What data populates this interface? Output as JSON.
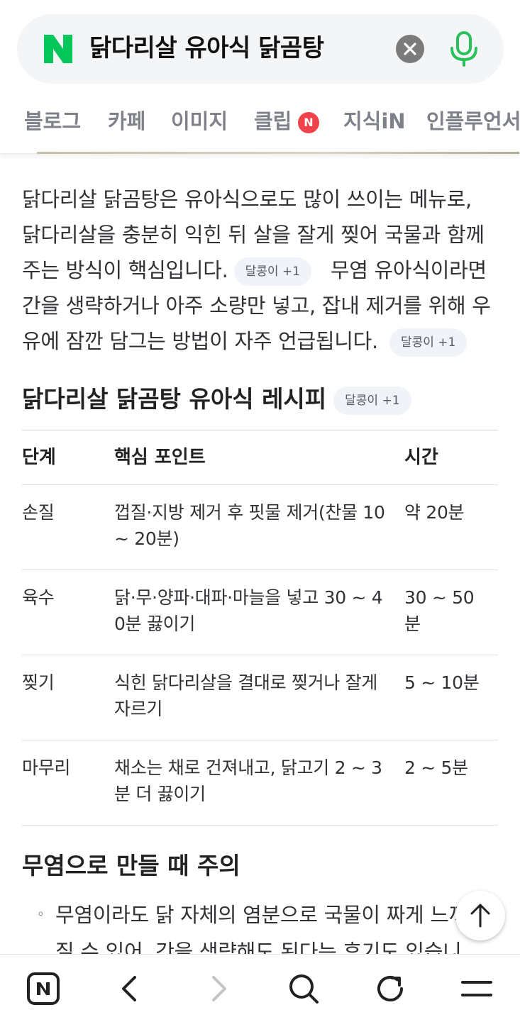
{
  "search": {
    "logo": "N",
    "query": "닭다리살 유아식 닭곰탕",
    "clear_icon": "close-icon",
    "mic_icon": "microphone-icon",
    "brand_color": "#03c75a"
  },
  "tabs": [
    {
      "label": "블로그"
    },
    {
      "label": "카페"
    },
    {
      "label": "이미지"
    },
    {
      "label": "클립",
      "badge": "N"
    },
    {
      "label": "지식iN"
    },
    {
      "label": "인플루언서"
    }
  ],
  "content": {
    "paragraph_lines": [
      "닭다리살 닭곰탕은 유아식으로도 많이 쓰이는 메뉴로,",
      "닭다리살을 충분히 익힌 뒤 살을 잘게 찢어 국물과 함께",
      "주는 방식이 핵심입니다.",
      "무염 유아식이라면",
      "간을 생략하거나 아주 소량만 넣고, 잡내 제거를 위해 우",
      "유에 잠깐 담그는 방법이 자주 언급됩니다."
    ],
    "chip_label": "달콩이 +1",
    "recipe_title": "닭다리살 닭곰탕 유아식 레시피",
    "table": {
      "headers": [
        "단계",
        "핵심 포인트",
        "시간"
      ],
      "rows": [
        {
          "step": "손질",
          "point_lines": [
            "껍질·지방 제거 후 핏물 제거(찬물 10",
            "~ 20분)"
          ],
          "time_lines": [
            "약 20분"
          ]
        },
        {
          "step": "육수",
          "point_lines": [
            "닭·무·양파·대파·마늘을 넣고 30 ~ 4",
            "0분 끓이기"
          ],
          "time_lines": [
            "30 ~ 50",
            "분"
          ]
        },
        {
          "step": "찢기",
          "point_lines": [
            "식힌 닭다리살을 결대로 찢거나 잘게",
            "자르기"
          ],
          "time_lines": [
            "5 ~ 10분"
          ]
        },
        {
          "step": "마무리",
          "point_lines": [
            "채소는 채로 건져내고, 닭고기 2 ~ 3",
            "분 더 끓이기"
          ],
          "time_lines": [
            "2 ~ 5분"
          ]
        }
      ]
    },
    "caution_title": "무염으로 만들 때 주의",
    "caution_bullet_lines": [
      "무염이라도 닭 자체의 염분으로 국물이 짜게 느껴",
      "질 수 있어, 간을 생략해도 된다는 후기도 있습니"
    ]
  },
  "bottom_nav": [
    {
      "icon": "naver-home-icon"
    },
    {
      "icon": "back-arrow-icon"
    },
    {
      "icon": "forward-arrow-icon"
    },
    {
      "icon": "search-icon"
    },
    {
      "icon": "refresh-icon"
    },
    {
      "icon": "menu-icon"
    }
  ],
  "scroll_top_icon": "arrow-up-icon"
}
